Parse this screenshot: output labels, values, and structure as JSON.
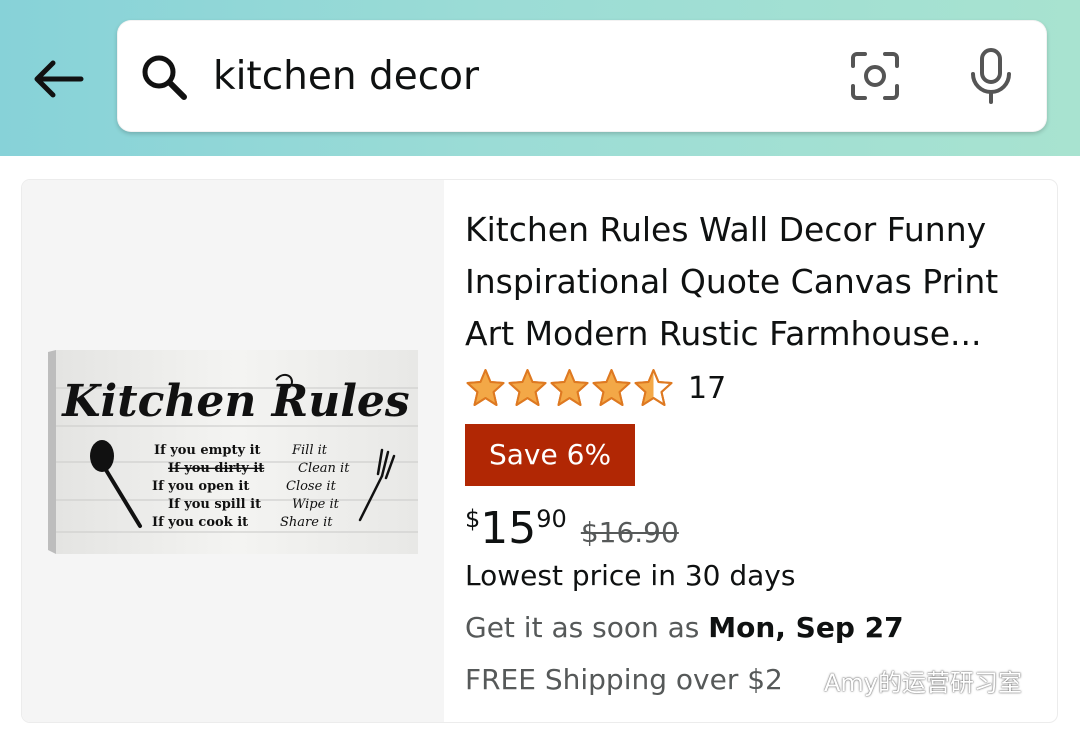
{
  "search": {
    "query": "kitchen decor"
  },
  "icons": {
    "back": "arrow-left-icon",
    "search": "search-icon",
    "camera": "camera-scan-icon",
    "mic": "microphone-icon"
  },
  "product": {
    "title": "Kitchen Rules Wall Decor Funny Inspirational Quote Canvas Print Art Modern Rustic Farmhouse...",
    "rating": 4.5,
    "rating_count": "17",
    "deal_badge": "Save 6%",
    "price_symbol": "$",
    "price_whole": "15",
    "price_fraction": "90",
    "price_was": "$16.90",
    "lowest_price_note": "Lowest price in 30 days",
    "delivery_prefix": "Get it as soon as",
    "delivery_date": "Mon, Sep 27",
    "shipping": "FREE Shipping over $2",
    "image": {
      "heading": "Kitchen Rules",
      "lines": [
        {
          "left": "If you empty it",
          "right": "Fill it"
        },
        {
          "left": "If you dirty it",
          "right": "Clean it"
        },
        {
          "left": "If you open it",
          "right": "Close it"
        },
        {
          "left": "If you spill it",
          "right": "Wipe it"
        },
        {
          "left": "If you cook it",
          "right": "Share it"
        }
      ]
    }
  },
  "watermark": "Amy的运营研习室",
  "colors": {
    "header_start": "#87d2d8",
    "header_end": "#a8e3d0",
    "deal_badge": "#b12704",
    "star": "#f3a847",
    "secondary_text": "#565959"
  }
}
